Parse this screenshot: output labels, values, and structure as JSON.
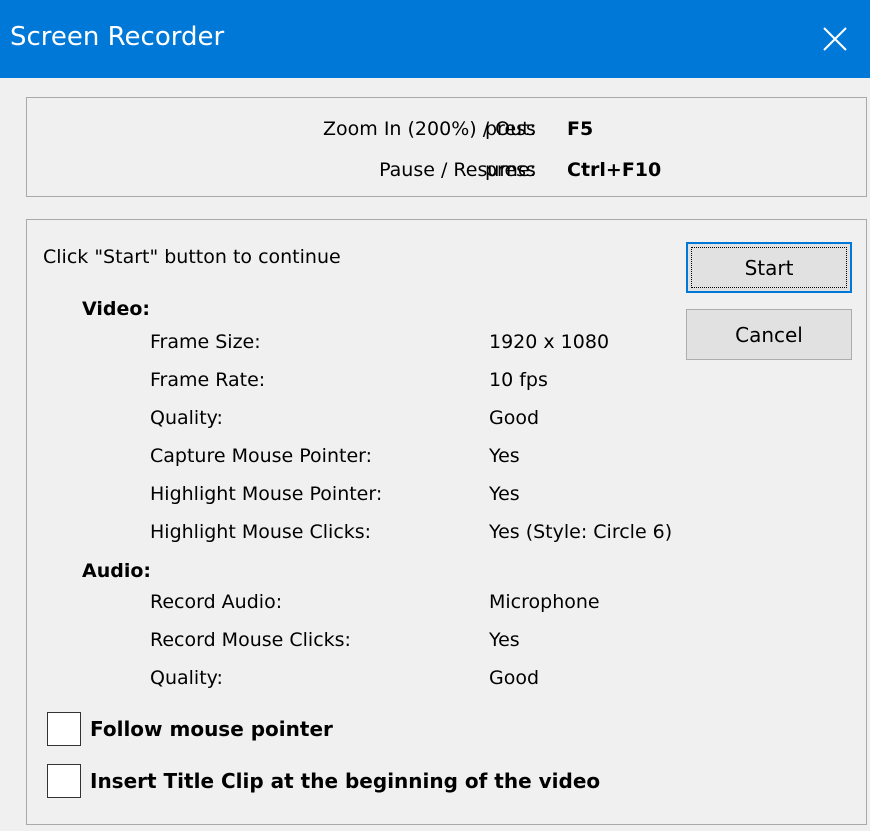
{
  "window": {
    "title": "Screen Recorder"
  },
  "hotkeys": [
    {
      "label": "Zoom In (200%) / Out:",
      "press": "press",
      "key": "F5"
    },
    {
      "label": "Pause / Resume:",
      "press": "press",
      "key": "Ctrl+F10"
    }
  ],
  "instruction": "Click \"Start\" button to continue",
  "buttons": {
    "start": "Start",
    "cancel": "Cancel"
  },
  "video": {
    "heading": "Video:",
    "rows": [
      {
        "label": "Frame Size:",
        "value": "1920 x 1080"
      },
      {
        "label": "Frame Rate:",
        "value": "10 fps"
      },
      {
        "label": "Quality:",
        "value": "Good"
      },
      {
        "label": "Capture Mouse Pointer:",
        "value": "Yes"
      },
      {
        "label": "Highlight Mouse Pointer:",
        "value": "Yes"
      },
      {
        "label": "Highlight Mouse Clicks:",
        "value": "Yes (Style: Circle 6)"
      }
    ]
  },
  "audio": {
    "heading": "Audio:",
    "rows": [
      {
        "label": "Record Audio:",
        "value": "Microphone"
      },
      {
        "label": "Record Mouse Clicks:",
        "value": "Yes"
      },
      {
        "label": "Quality:",
        "value": "Good"
      }
    ]
  },
  "options": [
    {
      "label": "Follow mouse pointer",
      "checked": false
    },
    {
      "label": "Insert Title Clip at the beginning of the video",
      "checked": false
    }
  ],
  "colors": {
    "titlebar": "#0078d7",
    "background": "#f0f0f0"
  }
}
